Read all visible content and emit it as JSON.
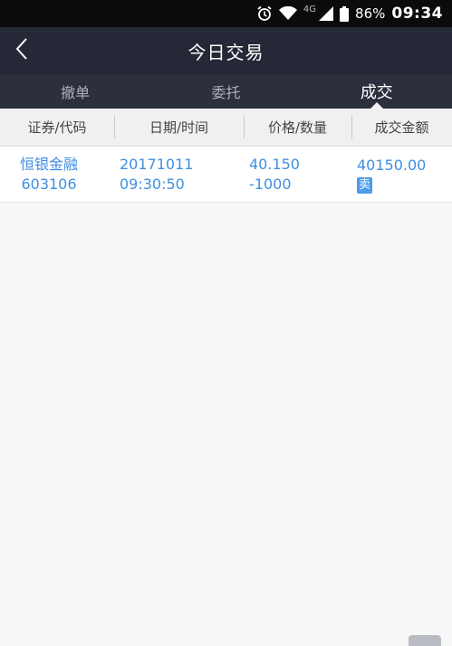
{
  "status_bar": {
    "network": "4G",
    "battery": "86%",
    "time": "09:34",
    "icons": [
      "alarm-icon",
      "wifi-icon",
      "signal-icon",
      "battery-icon"
    ]
  },
  "nav": {
    "title": "今日交易",
    "back_icon": "chevron-left-icon"
  },
  "tabs": [
    {
      "label": "撤单",
      "active": false
    },
    {
      "label": "委托",
      "active": false
    },
    {
      "label": "成交",
      "active": true
    }
  ],
  "table": {
    "headers": [
      "证券/代码",
      "日期/时间",
      "价格/数量",
      "成交金额"
    ],
    "rows": [
      {
        "name": "恒银金融",
        "code": "603106",
        "date": "20171011",
        "time": "09:30:50",
        "price": "40.150",
        "quantity": "-1000",
        "amount": "40150.00",
        "side": "卖"
      }
    ]
  },
  "colors": {
    "nav_bg": "#252836",
    "tab_bg": "#2c303d",
    "accent_blue": "#3f8fe0",
    "badge_blue": "#4a9be8"
  }
}
